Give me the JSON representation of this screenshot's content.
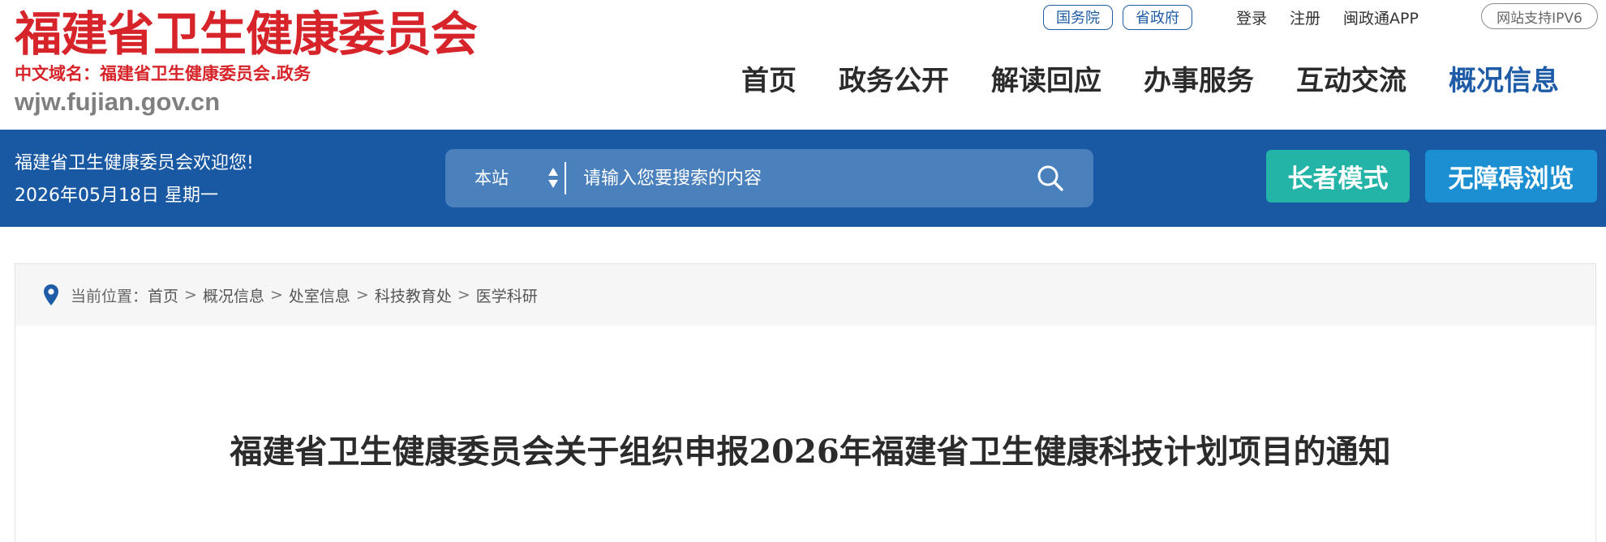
{
  "site": {
    "title": "福建省卫生健康委员会",
    "domain_label": "中文域名：福建省卫生健康委员会.政务",
    "url": "wjw.fujian.gov.cn"
  },
  "top_links": {
    "guowuyuan": "国务院",
    "shengzhengfu": "省政府",
    "login": "登录",
    "register": "注册",
    "app": "闽政通APP",
    "ipv6": "网站支持IPV6"
  },
  "nav": {
    "items": [
      {
        "label": "首页"
      },
      {
        "label": "政务公开"
      },
      {
        "label": "解读回应"
      },
      {
        "label": "办事服务"
      },
      {
        "label": "互动交流"
      },
      {
        "label": "概况信息",
        "active": true
      }
    ],
    "active_color": "#1f5ca8"
  },
  "banner": {
    "welcome": "福建省卫生健康委员会欢迎您!",
    "date": "2026年05月18日 星期一",
    "bg_color": "#1958a2"
  },
  "search": {
    "scope": "本站",
    "placeholder": "请输入您要搜索的内容",
    "icon": "search-icon"
  },
  "buttons": {
    "elder_mode": "长者模式",
    "accessible": "无障碍浏览",
    "elder_color": "#23b4a7",
    "accessible_color": "#1b8fd1"
  },
  "breadcrumb": {
    "prefix": "当前位置：",
    "icon": "location-pin-icon",
    "items": [
      "首页",
      "概况信息",
      "处室信息",
      "科技教育处",
      "医学科研"
    ],
    "separator": ">"
  },
  "article": {
    "title": "福建省卫生健康委员会关于组织申报2026年福建省卫生健康科技计划项目的通知"
  }
}
